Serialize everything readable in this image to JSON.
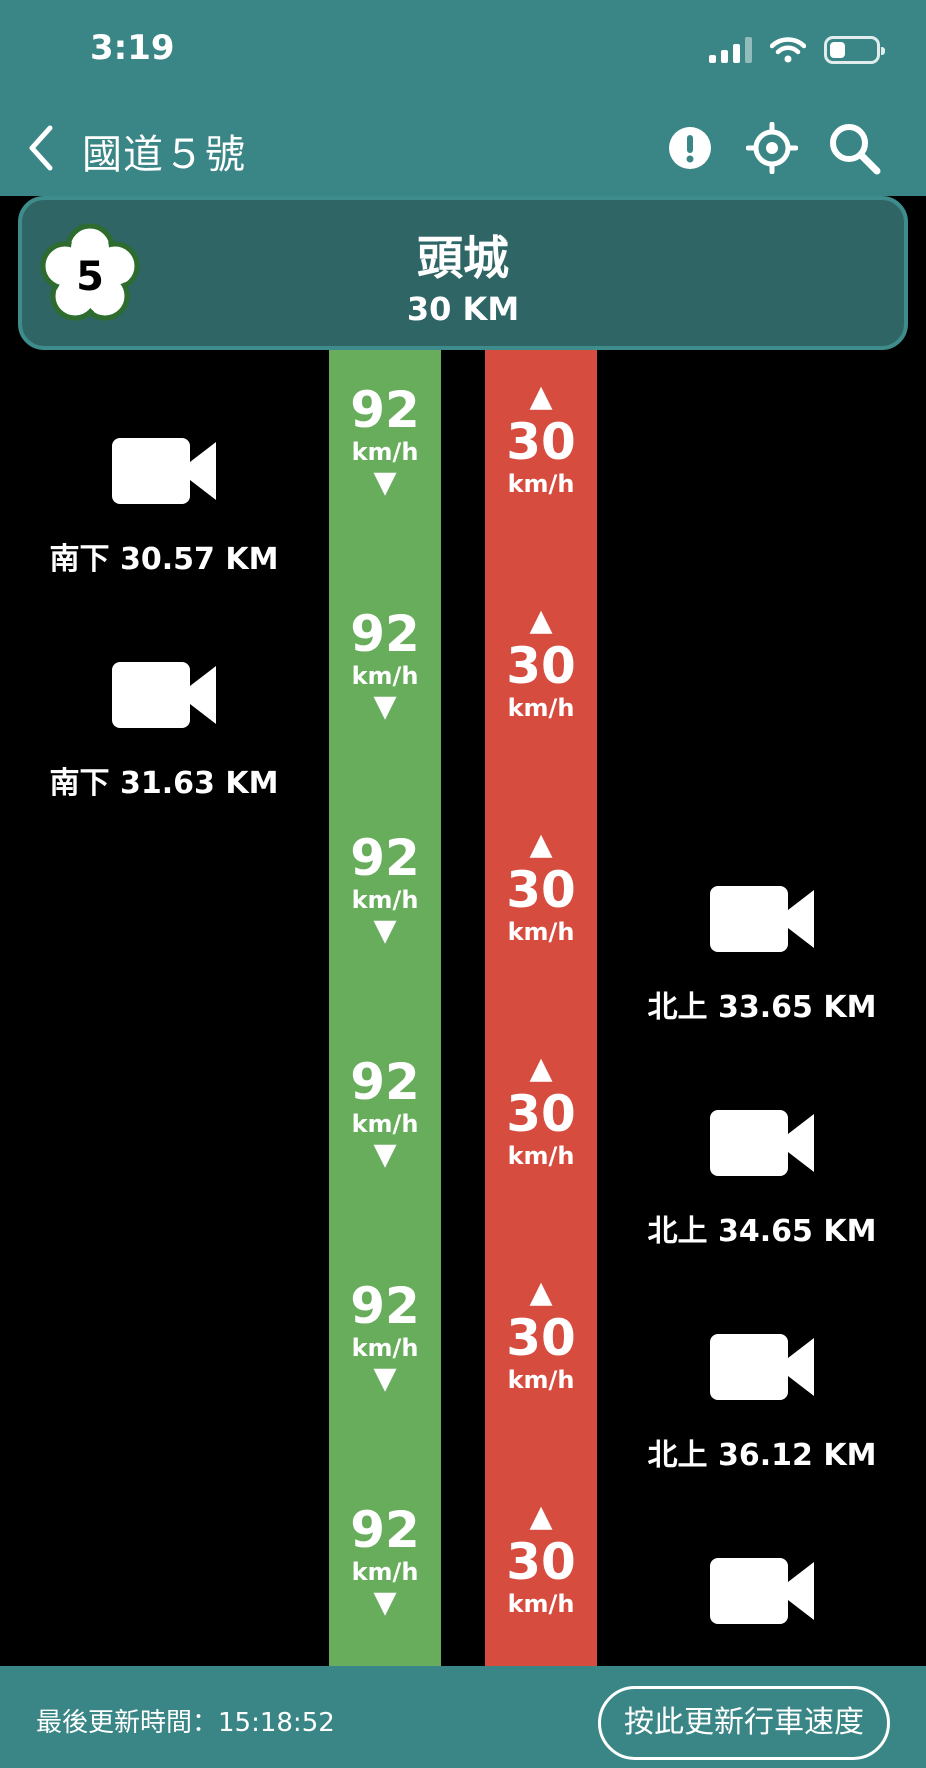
{
  "status_bar": {
    "time": "3:19",
    "battery_level": 0.34
  },
  "nav": {
    "title": "國道５號"
  },
  "banner": {
    "route_number": "5",
    "interchange": "頭城",
    "km": "30 KM"
  },
  "speed": {
    "south": {
      "value": "92",
      "unit": "km/h",
      "arrow": "▼"
    },
    "north": {
      "value": "30",
      "unit": "km/h",
      "arrow": "▲"
    }
  },
  "cameras": {
    "south": [
      {
        "label": "南下 30.57 KM"
      },
      {
        "label": "南下 31.63 KM"
      }
    ],
    "north": [
      {
        "label": "北上 33.65 KM"
      },
      {
        "label": "北上 34.65 KM"
      },
      {
        "label": "北上 36.12 KM"
      }
    ]
  },
  "footer": {
    "update_time": "最後更新時間：15:18:52",
    "refresh_label": "按此更新行車速度"
  },
  "colors": {
    "header_bg": "#3a8585",
    "banner_bg": "#2f6565",
    "south_strip": "#68ad5b",
    "north_strip": "#d64c3f"
  }
}
